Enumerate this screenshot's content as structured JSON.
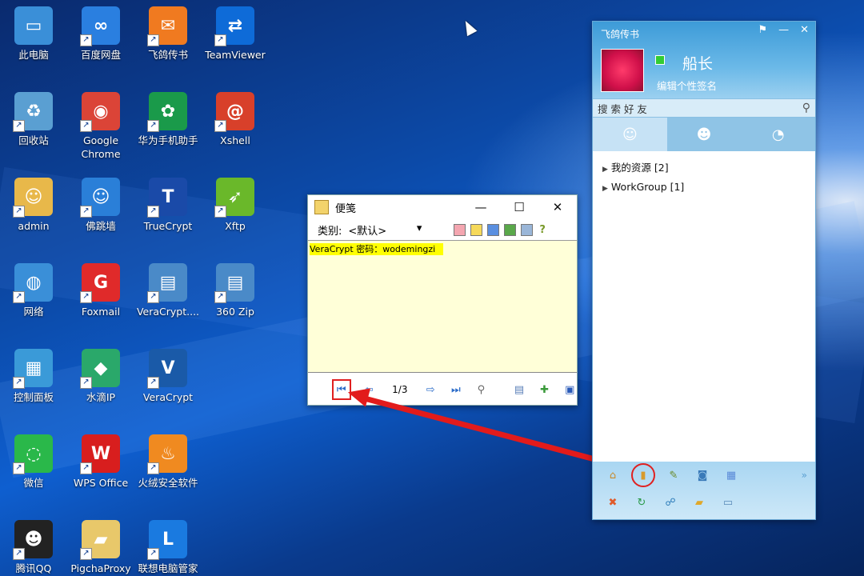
{
  "desktop": {
    "icons": [
      {
        "label": "此电脑",
        "icon": "computer-icon",
        "color": "#3a8fd8"
      },
      {
        "label": "百度网盘",
        "icon": "baidu-netdisk-icon",
        "color": "#2a7fe0"
      },
      {
        "label": "飞鸽传书",
        "icon": "feige-icon",
        "color": "#f07a20"
      },
      {
        "label": "TeamViewer",
        "icon": "teamviewer-icon",
        "color": "#0e6bd8"
      },
      {
        "label": "回收站",
        "icon": "recycle-bin-icon",
        "color": "#5a9fd2"
      },
      {
        "label": "Google Chrome",
        "icon": "chrome-icon",
        "color": "#db4437"
      },
      {
        "label": "华为手机助手",
        "icon": "huawei-assistant-icon",
        "color": "#1a9a4a"
      },
      {
        "label": "Xshell",
        "icon": "xshell-icon",
        "color": "#d8402a"
      },
      {
        "label": "admin",
        "icon": "user-folder-icon",
        "color": "#e8b84a"
      },
      {
        "label": "佛跳墙",
        "icon": "fotiaoqiang-icon",
        "color": "#2a7fd8"
      },
      {
        "label": "TrueCrypt",
        "icon": "truecrypt-icon",
        "color": "#1a4aa8"
      },
      {
        "label": "Xftp",
        "icon": "xftp-icon",
        "color": "#6ab82a"
      },
      {
        "label": "网络",
        "icon": "network-icon",
        "color": "#3a8fd8"
      },
      {
        "label": "Foxmail",
        "icon": "foxmail-icon",
        "color": "#e02a2a"
      },
      {
        "label": "VeraCrypt....",
        "icon": "zip-archive-icon",
        "color": "#4a8ac8"
      },
      {
        "label": "360 Zip",
        "icon": "zip-archive-icon",
        "color": "#4a8ac8"
      },
      {
        "label": "控制面板",
        "icon": "control-panel-icon",
        "color": "#3a9ad8"
      },
      {
        "label": "水滴IP",
        "icon": "shuidi-ip-icon",
        "color": "#2aa86a"
      },
      {
        "label": "VeraCrypt",
        "icon": "veracrypt-icon",
        "color": "#1a5aa8"
      },
      {
        "label": "微信",
        "icon": "wechat-icon",
        "color": "#2ab84a"
      },
      {
        "label": "WPS Office",
        "icon": "wps-icon",
        "color": "#d81e1e"
      },
      {
        "label": "火绒安全软件",
        "icon": "huorong-icon",
        "color": "#f08a20"
      },
      {
        "label": "腾讯QQ",
        "icon": "qq-icon",
        "color": "#222222"
      },
      {
        "label": "PigchaProxy",
        "icon": "folder-icon",
        "color": "#e8c86a"
      },
      {
        "label": "联想电脑管家",
        "icon": "lenovo-manager-icon",
        "color": "#1a7ae0"
      }
    ]
  },
  "note": {
    "title": "便笺",
    "category_label": "类别:",
    "category_value": "<默认>",
    "content": "VeraCrypt 密码：wodemingzi",
    "page": "1/3",
    "controls": {
      "min": "—",
      "max": "☐",
      "close": "✕"
    },
    "swatch_colors": [
      "#f4a6b0",
      "#f6d95a",
      "#5a8fe0",
      "#5aa84a",
      "#9ab6d8"
    ],
    "help": "?"
  },
  "feige": {
    "title": "飞鸽传书",
    "username": "船长",
    "signature": "编辑个性签名",
    "search_placeholder": "搜 索 好 友",
    "groups": [
      {
        "label": "我的资源 [2]"
      },
      {
        "label": "WorkGroup [1]"
      }
    ],
    "more": "»"
  },
  "accent": "#e21b1b"
}
